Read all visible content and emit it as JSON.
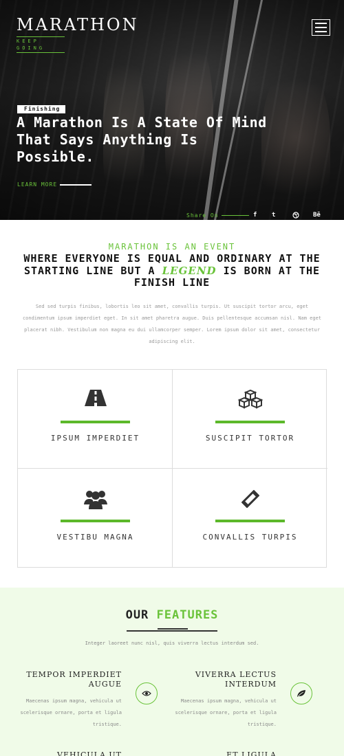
{
  "hero": {
    "brand": "MARATHON",
    "tagline_1": "KEEP",
    "tagline_2": "GOING",
    "badge": "Finishing",
    "title": "A Marathon Is A State Of Mind That Says Anything Is Possible.",
    "learn_more": "LEARN MORE",
    "share_label": "Share On",
    "social": [
      "f",
      "t",
      "d",
      "Bē"
    ]
  },
  "event": {
    "subtitle": "MARATHON IS AN EVENT",
    "title_part1": "WHERE EVERYONE IS EQUAL AND ORDINARY AT THE STARTING LINE BUT A ",
    "title_legend": "LEGEND",
    "title_part2": " IS BORN AT THE FINISH LINE",
    "paragraph": "Sed sed turpis finibus, lobortis leo sit amet, convallis turpis. Ut suscipit tortor arcu, eget condimentum ipsum imperdiet eget. In sit amet pharetra augue. Duis pellentesque accumsan nisl. Nam eget placerat nibh. Vestibulum non magna eu dui ullamcorper semper. Lorem ipsum dolor sit amet, consectetur adipiscing elit.",
    "cards": [
      {
        "label": "IPSUM IMPERDIET",
        "icon": "road-icon"
      },
      {
        "label": "SUSCIPIT TORTOR",
        "icon": "cubes-icon"
      },
      {
        "label": "VESTIBU MAGNA",
        "icon": "users-icon"
      },
      {
        "label": "CONVALLIS TURPIS",
        "icon": "ticket-icon"
      }
    ]
  },
  "features": {
    "title_plain": "OUR ",
    "title_highlight": "FEATURES",
    "description": "Integer laoreet nunc nisl, quis viverra lectus interdum sed.",
    "items": [
      {
        "title": "TEMPOR IMPERDIET AUGUE",
        "text": "Maecenas ipsum magna, vehicula ut scelerisque ornare, porta et ligula tristique.",
        "icon": "eye-icon"
      },
      {
        "title": "VIVERRA LECTUS INTERDUM",
        "text": "Maecenas ipsum magna, vehicula ut scelerisque ornare, porta et ligula tristique.",
        "icon": "leaf-icon"
      },
      {
        "title": "VEHICULA UT ORNARE",
        "text": ""
      },
      {
        "title": "ET LIGULA TRISTIQUE",
        "text": ""
      }
    ]
  },
  "colors": {
    "accent": "#6ac33a",
    "features_bg": "#f0fbe8"
  }
}
